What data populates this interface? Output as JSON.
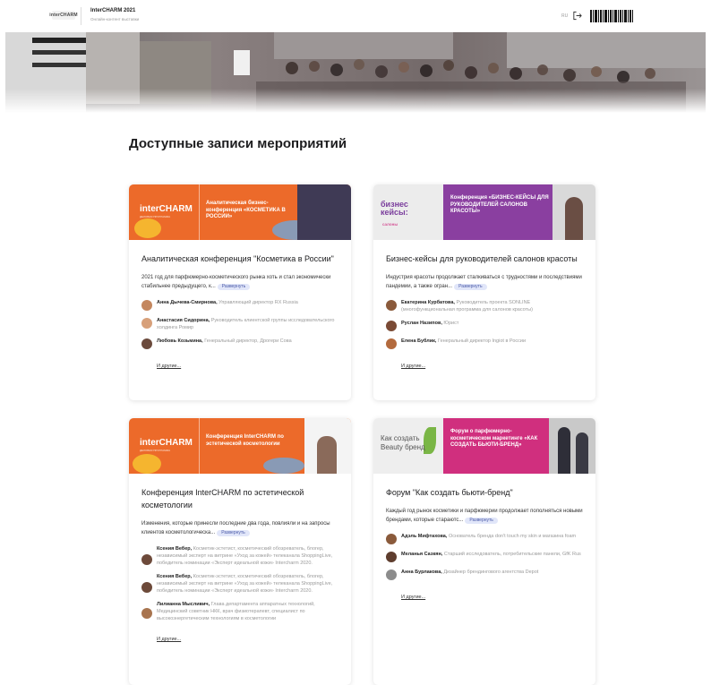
{
  "header": {
    "logo_text": "interCHARM",
    "title": "InterCHARM 2021",
    "subtitle": "Онлайн-контент выставки",
    "lang": "RU"
  },
  "page": {
    "title": "Доступные записи мероприятий"
  },
  "cards": [
    {
      "img_label": "Аналитическая бизнес-конференция «КОСМЕТИКА В РОССИИ»",
      "img_logo": "interCHARM",
      "img_logo_sub": "ДЕЛОВАЯ ПРОГРАММА",
      "title": "Аналитическая конференция \"Косметика в России\"",
      "desc": "2021 год для парфюмерно-косметического рынка хоть и стал экономически стабильнее предыдущего, к...",
      "expand": "Развернуть",
      "speakers": [
        {
          "name": "Анна Дычева-Смирнова,",
          "role": "Управляющий директор RX Russia",
          "avatar": "#c4875f"
        },
        {
          "name": "Анастасия Сидорина,",
          "role": "Руководитель клиентской группы исследовательского холдинга Ромир",
          "avatar": "#d7a07a"
        },
        {
          "name": "Любовь Козьмина,",
          "role": "Генеральный директор, Дрогери Сова",
          "avatar": "#6b4a3c"
        }
      ],
      "more": "И другие..."
    },
    {
      "img_label": "Конференция «БИЗНЕС-КЕЙСЫ ДЛЯ РУКОВОДИТЕЛЕЙ САЛОНОВ КРАСОТЫ»",
      "img_logo": "бизнес кейсы:",
      "img_logo_sub": "салоны",
      "title": "Бизнес-кейсы для руководителей салонов красоты",
      "desc": "Индустрия красоты продолжает сталкиваться с трудностями и последствиями пандемии, а также огран...",
      "expand": "Развернуть",
      "speakers": [
        {
          "name": "Екатерина Курбатова,",
          "role": "Руководитель проекта SONLINE (многофункциональная программа для салонов красоты)",
          "avatar": "#8a5a3b"
        },
        {
          "name": "Руслан Назипов,",
          "role": "Юрист",
          "avatar": "#7a4a35"
        },
        {
          "name": "Елена Бублик,",
          "role": "Генеральный директор Ingiot в России",
          "avatar": "#b36a3d"
        }
      ],
      "more": "И другие..."
    },
    {
      "img_label": "Конференция InterCHARM по эстетической косметологии",
      "img_logo": "interCHARM",
      "img_logo_sub": "ДЕЛОВАЯ ПРОГРАММА",
      "title": "Конференция InterCHARM по эстетической косметологии",
      "desc": "Изменения, которые принесли последние два года, повлияли и на запросы клиентов косметологическа...",
      "expand": "Развернуть",
      "speakers": [
        {
          "name": "Ксения Вебер,",
          "role": "Косметик-эстетист, косметический обозреватель, блогер, независимый эксперт на витрине «Уход за кожей» телеканала ShoppingLive, победитель номинации «Эксперт идеальной кожи» Intercharm 2020.",
          "avatar": "#6d4a3a"
        },
        {
          "name": "Ксения Вебер,",
          "role": "Косметик-эстетист, косметический обозреватель, блогер, независимый эксперт на витрине «Уход за кожей» телеканала ShoppingLive, победитель номинации «Эксперт идеальной кожи» Intercharm 2020.",
          "avatar": "#6d4a3a"
        },
        {
          "name": "Лилианна Мысливич,",
          "role": "Глава департамента аппаратных технологий, Медицинский советник НКК, врач физиотерапевт, специалист по высокоэнергетическим технологиям в косметологии",
          "avatar": "#a8744f"
        }
      ],
      "more": "И другие..."
    },
    {
      "img_label": "Форум о парфюмерно-косметическом маркетинге «КАК СОЗДАТЬ БЬЮТИ-БРЕНД»",
      "img_logo": "Как создать Beauty бренд",
      "img_logo_sub": "",
      "title": "Форум \"Как создать бьюти-бренд\"",
      "desc": "Каждый год рынок косметики и парфюмерии продолжает пополняться новыми брендами, которые стараютс...",
      "expand": "Развернуть",
      "speakers": [
        {
          "name": "Адэль Мифтахова,",
          "role": "Основатель бренда don't touch my skin и магазина foam",
          "avatar": "#8a5a3b"
        },
        {
          "name": "Меланья Сазкян,",
          "role": "Старший исследователь, потребительские панели, GfK Rus",
          "avatar": "#5e3d2e"
        },
        {
          "name": "Анна Бурлакова,",
          "role": "Дизайнер брендингового агентства Depot",
          "avatar": "#8c8c8c"
        }
      ],
      "more": "И другие..."
    }
  ]
}
